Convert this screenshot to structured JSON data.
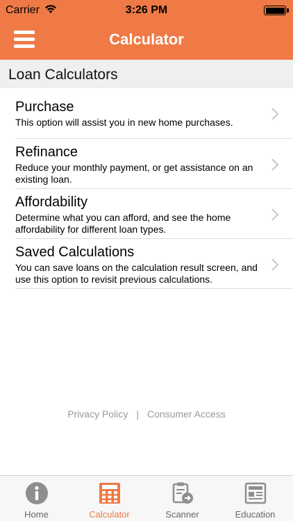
{
  "status_bar": {
    "carrier": "Carrier",
    "time": "3:26 PM",
    "battery_level": 1.0
  },
  "nav": {
    "title": "Calculator",
    "menu_icon": "hamburger-menu-icon"
  },
  "section": {
    "title": "Loan Calculators"
  },
  "rows": [
    {
      "title": "Purchase",
      "description": "This option will assist you in new home purchases."
    },
    {
      "title": "Refinance",
      "description": "Reduce your monthly payment, or get assistance on an existing loan."
    },
    {
      "title": "Affordability",
      "description": "Determine what you can afford, and see the home affordability for different loan types."
    },
    {
      "title": "Saved Calculations",
      "description": "You can save loans on the calculation result screen, and use this option to revisit previous calculations."
    }
  ],
  "footer": {
    "privacy": "Privacy Policy",
    "separator": "|",
    "consumer": "Consumer Access"
  },
  "tabs": [
    {
      "label": "Home",
      "icon": "info-icon",
      "active": false
    },
    {
      "label": "Calculator",
      "icon": "calculator-icon",
      "active": true
    },
    {
      "label": "Scanner",
      "icon": "document-scanner-icon",
      "active": false
    },
    {
      "label": "Education",
      "icon": "newspaper-icon",
      "active": false
    }
  ],
  "colors": {
    "accent": "#ef7a45",
    "section_bg": "#efefef",
    "inactive_tab": "#666666",
    "footer_link": "#999999"
  }
}
